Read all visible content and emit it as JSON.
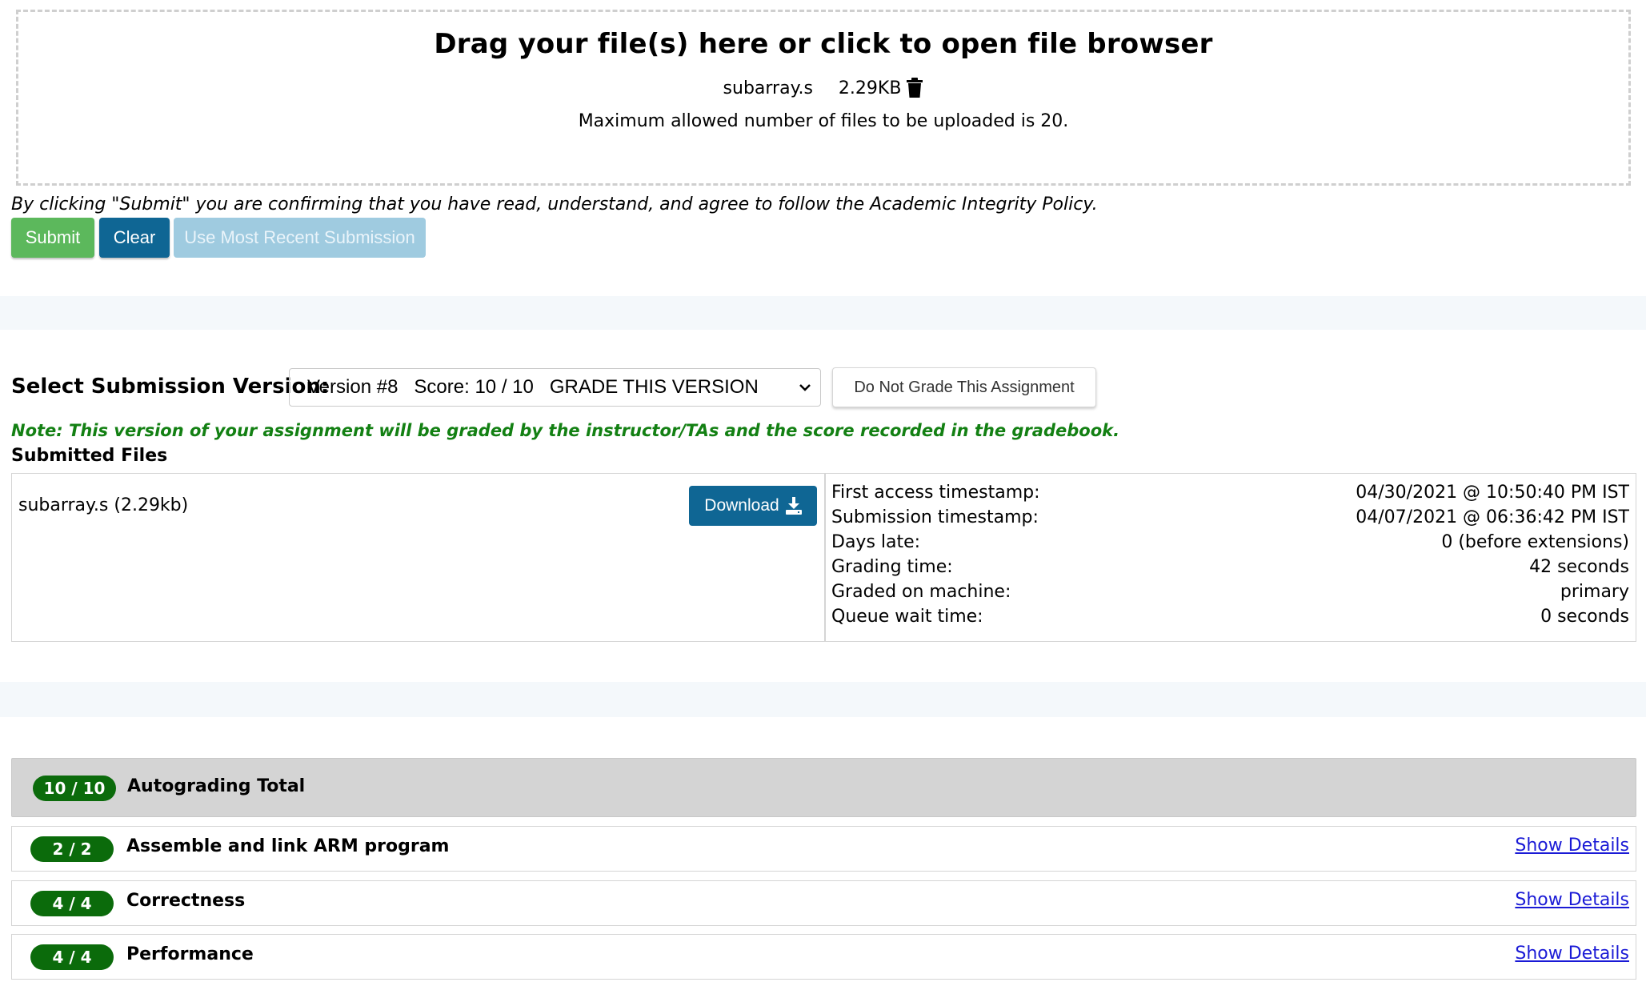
{
  "upload": {
    "title": "Drag your file(s) here or click to open file browser",
    "file_name": "subarray.s",
    "file_size": "2.29KB",
    "trash_icon": "trash-icon",
    "max_files_text": "Maximum allowed number of files to be uploaded is 20."
  },
  "agreement_text": "By clicking \"Submit\" you are confirming that you have read, understand, and agree to follow the Academic Integrity Policy.",
  "buttons": {
    "submit": "Submit",
    "clear": "Clear",
    "use_recent": "Use Most Recent Submission"
  },
  "version": {
    "label": "Select Submission Version:",
    "selected": "Version #8   Score: 10 / 10   GRADE THIS VERSION",
    "no_grade_button": "Do Not Grade This Assignment",
    "note": "Note: This version of your assignment will be graded by the instructor/TAs and the score recorded in the gradebook."
  },
  "submitted_files": {
    "label": "Submitted Files",
    "files": [
      {
        "name": "subarray.s (2.29kb)",
        "download_label": "Download"
      }
    ]
  },
  "submission_info": [
    {
      "label": "First access timestamp:",
      "value": "04/30/2021 @ 10:50:40 PM IST"
    },
    {
      "label": "Submission timestamp:",
      "value": "04/07/2021 @ 06:36:42 PM IST"
    },
    {
      "label": "Days late:",
      "value": "0 (before extensions)"
    },
    {
      "label": "Grading time:",
      "value": "42 seconds"
    },
    {
      "label": "Graded on machine:",
      "value": "primary"
    },
    {
      "label": "Queue wait time:",
      "value": "0 seconds"
    }
  ],
  "autograding": {
    "total": {
      "score": "10 / 10",
      "label": "Autograding Total"
    },
    "tests": [
      {
        "score": "2 / 2",
        "label": "Assemble and link ARM program",
        "link": "Show Details"
      },
      {
        "score": "4 / 4",
        "label": "Correctness",
        "link": "Show Details"
      },
      {
        "score": "4 / 4",
        "label": "Performance",
        "link": "Show Details"
      }
    ]
  },
  "colors": {
    "submit": "#5cb85c",
    "primary": "#0f6694",
    "disabled": "#9fcbe0",
    "note_green": "#138013",
    "pill_green": "#0b6b0b",
    "link": "#1a1ad6"
  }
}
